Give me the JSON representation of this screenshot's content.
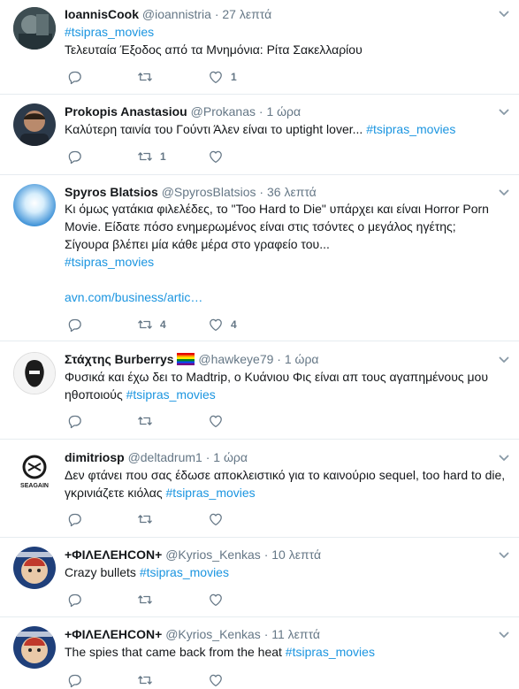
{
  "tweets": [
    {
      "name": "IoannisCook",
      "handle": "@ioannistria",
      "time": "27 λεπτά",
      "hashtag": "#tsipras_movies",
      "text": "Τελευταία Έξοδος από τα Μνημόνια: Ρίτα Σακελλαρίου",
      "retweets": "",
      "likes": "1"
    },
    {
      "name": "Prokopis Anastasiou",
      "handle": "@Prokanas",
      "time": "1 ώρα",
      "text": "Καλύτερη ταινία του Γούντι Άλεν είναι το uptight lover...",
      "hashtag": "#tsipras_movies",
      "retweets": "1",
      "likes": ""
    },
    {
      "name": "Spyros Blatsios",
      "handle": "@SpyrosBlatsios",
      "time": "36 λεπτά",
      "text_line1": "Κι όμως γατάκια φιλελέδες, το \"Too Hard to Die\" υπάρχει και είναι Horror Porn",
      "text_line2": "Movie. Είδατε πόσο ενημερωμένος είναι στις τσόντες ο μεγάλος ηγέτης;",
      "text_line3": "Σίγουρα βλέπει μία κάθε μέρα στο γραφείο του...",
      "hashtag": "#tsipras_movies",
      "link": "avn.com/business/artic…",
      "retweets": "4",
      "likes": "4"
    },
    {
      "name": "Στάχτης Burberrys",
      "handle": "@hawkeye79",
      "time": "1 ώρα",
      "text_line1": "Φυσικά και έχω δει το Madtrip, ο Κυάνιου Φις είναι απ τους αγαπημένους μου",
      "text_line2": "ηθοποιούς",
      "hashtag": "#tsipras_movies",
      "retweets": "",
      "likes": ""
    },
    {
      "name": "dimitriosp",
      "handle": "@deltadrum1",
      "time": "1 ώρα",
      "text_line1": "Δεν φτάνει που σας έδωσε αποκλειστικό για το καινούριο sequel, too hard to die,",
      "text_line2": "γκρινιάζετε κιόλας",
      "hashtag": "#tsipras_movies",
      "avatar_text": "SEAGAIN",
      "retweets": "",
      "likes": ""
    },
    {
      "name": "+ΦΙΛΕΛΕΗCON+",
      "handle": "@Kyrios_Kenkas",
      "time": "10 λεπτά",
      "text": "Crazy bullets",
      "hashtag": "#tsipras_movies",
      "retweets": "",
      "likes": ""
    },
    {
      "name": "+ΦΙΛΕΛΕΗCON+",
      "handle": "@Kyrios_Kenkas",
      "time": "11 λεπτά",
      "text": "The spies that came back from the heat",
      "hashtag": "#tsipras_movies",
      "retweets": "",
      "likes": ""
    }
  ],
  "colors": {
    "link": "#1b95e0",
    "muted": "#657786",
    "border": "#e6ecf0"
  }
}
